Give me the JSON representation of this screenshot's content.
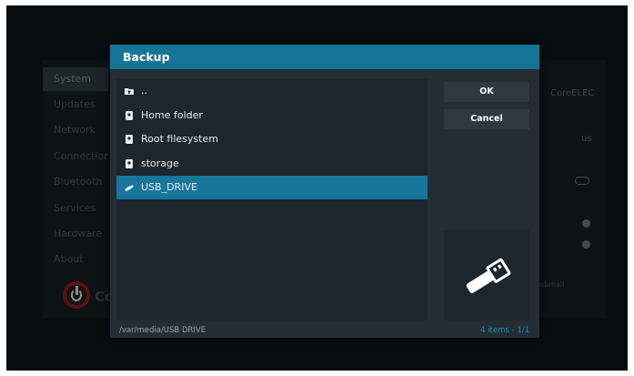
{
  "background": {
    "nav_items": [
      "System",
      "Updates",
      "Network",
      "Connections",
      "Bluetooth",
      "Services",
      "Hardware",
      "About"
    ],
    "right_label": "CoreELEC",
    "right_value": "us",
    "brand_text": "Co",
    "email_fragment": "nbmail"
  },
  "dialog": {
    "title": "Backup",
    "items": [
      {
        "label": "..",
        "icon": "folder-up-icon"
      },
      {
        "label": "Home folder",
        "icon": "drive-icon"
      },
      {
        "label": "Root filesystem",
        "icon": "drive-icon"
      },
      {
        "label": "storage",
        "icon": "drive-icon"
      },
      {
        "label": "USB_DRIVE",
        "icon": "usb-icon"
      }
    ],
    "selected_index": 4,
    "ok_label": "OK",
    "cancel_label": "Cancel",
    "preview_icon": "usb-drive-icon",
    "path": "/var/media/USB DRIVE",
    "count_label": "4 items",
    "count_separator": " - ",
    "page_label": "1/1"
  },
  "colors": {
    "accent": "#17769a",
    "header": "#167596",
    "count_text": "#1e8ac0"
  }
}
